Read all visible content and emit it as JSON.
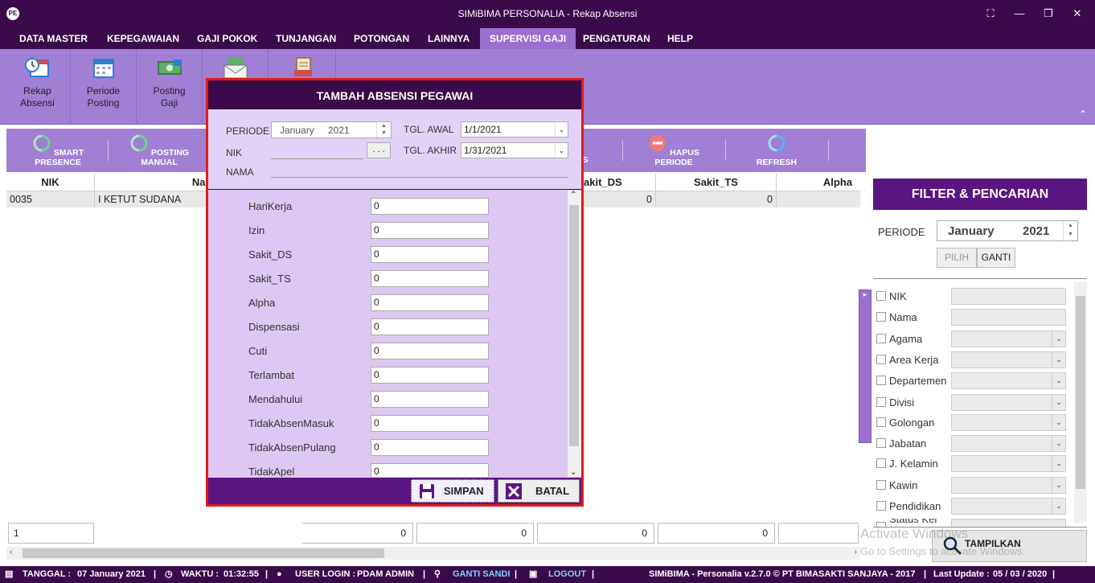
{
  "window": {
    "title": "SIMiBIMA PERSONALIA - Rekap Absensi",
    "logo_text": "PE",
    "controls": [
      "⛶",
      "—",
      "❐",
      "✕"
    ]
  },
  "menu": [
    "DATA MASTER",
    "KEPEGAWAIAN",
    "GAJI POKOK",
    "TUNJANGAN",
    "POTONGAN",
    "LAINNYA",
    "SUPERVISI GAJI",
    "PENGATURAN",
    "HELP"
  ],
  "menu_active": "SUPERVISI GAJI",
  "ribbon": [
    {
      "line1": "Rekap",
      "line2": "Absensi",
      "icon": "clock-calendar-icon"
    },
    {
      "line1": "Periode",
      "line2": "Posting",
      "icon": "calendar-icon"
    },
    {
      "line1": "Posting",
      "line2": "Gaji",
      "icon": "money-icon"
    },
    {
      "line1": "",
      "line2": "",
      "icon": "envelope-money-icon"
    },
    {
      "line1": "",
      "line2": "",
      "icon": "document-icon"
    }
  ],
  "toolbar": {
    "smart_presence": "SMART PRESENCE",
    "posting_manual": "POSTING MANUAL",
    "partial": "S",
    "hapus_periode": "HAPUS PERIODE",
    "refresh": "REFRESH"
  },
  "grid": {
    "columns": [
      "NIK",
      "Nam",
      "akit_DS",
      "Sakit_TS",
      "Alpha"
    ],
    "rows": [
      {
        "nik": "0035",
        "nama": "I KETUT SUDANA",
        "sakit_ds": "0",
        "sakit_ts": "0"
      }
    ],
    "totals": [
      "1",
      "0",
      "0",
      "0",
      "0"
    ]
  },
  "modal": {
    "title": "TAMBAH ABSENSI PEGAWAI",
    "periode_label": "PERIODE",
    "periode_month": "January",
    "periode_year": "2021",
    "nik_label": "NIK",
    "nik_button": ". . .",
    "nama_label": "NAMA",
    "tgl_awal_label": "TGL. AWAL",
    "tgl_awal": "1/1/2021",
    "tgl_akhir_label": "TGL. AKHIR",
    "tgl_akhir": "1/31/2021",
    "fields": [
      {
        "label": "HariKerja",
        "value": "0"
      },
      {
        "label": "Izin",
        "value": "0"
      },
      {
        "label": "Sakit_DS",
        "value": "0"
      },
      {
        "label": "Sakit_TS",
        "value": "0"
      },
      {
        "label": "Alpha",
        "value": "0"
      },
      {
        "label": "Dispensasi",
        "value": "0"
      },
      {
        "label": "Cuti",
        "value": "0"
      },
      {
        "label": "Terlambat",
        "value": "0"
      },
      {
        "label": "Mendahului",
        "value": "0"
      },
      {
        "label": "TidakAbsenMasuk",
        "value": "0"
      },
      {
        "label": "TidakAbsenPulang",
        "value": "0"
      },
      {
        "label": "TidakApel",
        "value": "0"
      }
    ],
    "save_label": "SIMPAN",
    "cancel_label": "BATAL"
  },
  "filter": {
    "title": "FILTER & PENCARIAN",
    "periode_label": "PERIODE",
    "periode_month": "January",
    "periode_year": "2021",
    "pilih_label": "PILIH",
    "ganti_label": "GANTI",
    "items": [
      "NIK",
      "Nama",
      "Agama",
      "Area Kerja",
      "Departemen",
      "Divisi",
      "Golongan",
      "Jabatan",
      "J. Kelamin",
      "Kawin",
      "Pendidikan",
      "Status Kel"
    ],
    "tampilkan_label": "TAMPILKAN",
    "watermark1": "Activate Windows",
    "watermark2": "Go to Settings to activate Windows."
  },
  "status": {
    "tanggal_label": "TANGGAL :",
    "tanggal": "07 January 2021",
    "waktu_label": "WAKTU :",
    "waktu": "01:32:55",
    "user_label": "USER LOGIN :",
    "user": "PDAM ADMIN",
    "ganti_sandi": "GANTI SANDI",
    "logout": "LOGOUT",
    "sep": "|",
    "app_info": "SIMiBIMA - Personalia v.2.7.0 © PT BIMASAKTI SANJAYA - 2017",
    "update_label": "Last Update :",
    "update": "05 / 03 / 2020"
  },
  "colors": {
    "brand": "#3a0a4a",
    "accent": "#a07fd4",
    "modal_border": "#e31a1a"
  }
}
